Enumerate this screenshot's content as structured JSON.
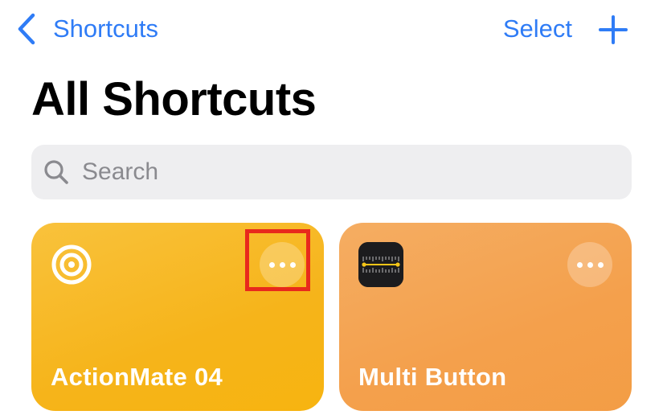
{
  "nav": {
    "back_label": "Shortcuts",
    "select_label": "Select",
    "accent_color": "#2f7cf6"
  },
  "page": {
    "title": "All Shortcuts"
  },
  "search": {
    "placeholder": "Search",
    "value": ""
  },
  "shortcuts": [
    {
      "title": "ActionMate 04",
      "icon": "target-icon",
      "color": "#f7b41a"
    },
    {
      "title": "Multi Button",
      "icon": "measure-app-icon",
      "color": "#f4a04c"
    }
  ],
  "highlight": {
    "color": "#e8291c"
  }
}
